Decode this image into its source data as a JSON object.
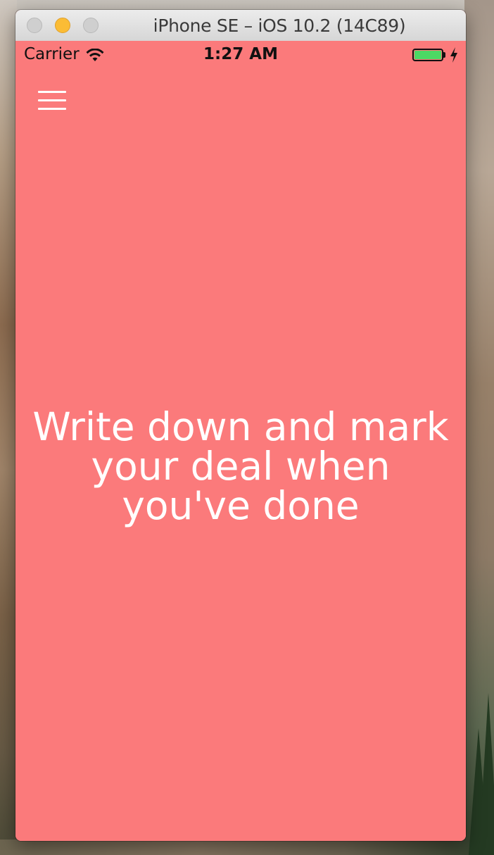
{
  "window": {
    "title": "iPhone SE – iOS 10.2 (14C89)"
  },
  "status_bar": {
    "carrier": "Carrier",
    "time": "1:27 AM",
    "icons": [
      "wifi-icon",
      "battery-icon",
      "charging-bolt-icon"
    ],
    "battery_color": "#4cd964"
  },
  "app": {
    "background_color": "#fb7a7b",
    "menu_icon": "hamburger-menu-icon",
    "empty_message": "Write down and mark your deal when you've done"
  }
}
